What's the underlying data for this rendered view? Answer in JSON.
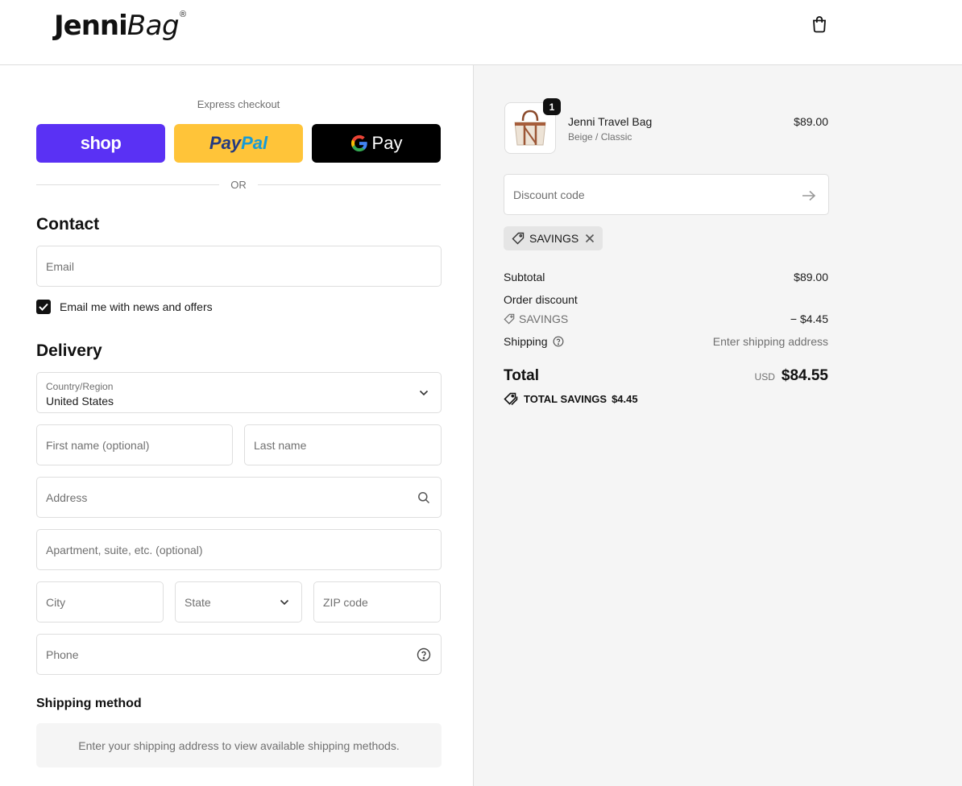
{
  "header": {
    "logo_bold": "Jenni",
    "logo_italic": "Bag",
    "logo_reg": "®",
    "cart_icon": "shopping-bag-icon"
  },
  "express": {
    "title": "Express checkout",
    "shop_label": "shop",
    "paypal_part1": "Pay",
    "paypal_part2": "Pal",
    "gpay_label": "Pay",
    "or_label": "OR"
  },
  "contact": {
    "title": "Contact",
    "email_placeholder": "Email",
    "newsletter_label": "Email me with news and offers",
    "newsletter_checked": true
  },
  "delivery": {
    "title": "Delivery",
    "country_label": "Country/Region",
    "country_value": "United States",
    "first_name_placeholder": "First name (optional)",
    "last_name_placeholder": "Last name",
    "address_placeholder": "Address",
    "apartment_placeholder": "Apartment, suite, etc. (optional)",
    "city_placeholder": "City",
    "state_placeholder": "State",
    "zip_placeholder": "ZIP code",
    "phone_placeholder": "Phone"
  },
  "shipping_method": {
    "title": "Shipping method",
    "info": "Enter your shipping address to view available shipping methods."
  },
  "summary": {
    "product": {
      "name": "Jenni Travel Bag",
      "variant": "Beige / Classic",
      "price": "$89.00",
      "quantity": "1"
    },
    "discount_placeholder": "Discount code",
    "applied_code": "SAVINGS",
    "subtotal_label": "Subtotal",
    "subtotal_value": "$89.00",
    "order_discount_label": "Order discount",
    "discount_code": "SAVINGS",
    "discount_value": "− $4.45",
    "shipping_label": "Shipping",
    "shipping_value": "Enter shipping address",
    "total_label": "Total",
    "currency": "USD",
    "total_value": "$84.55",
    "total_savings_label": "TOTAL SAVINGS",
    "total_savings_value": "$4.45"
  },
  "colors": {
    "shop_pay": "#5a31f4",
    "paypal": "#ffc439",
    "gpay": "#000000",
    "summary_bg": "#f5f5f5"
  }
}
